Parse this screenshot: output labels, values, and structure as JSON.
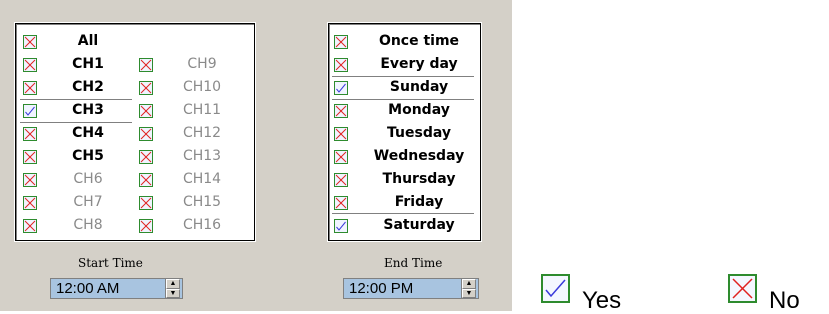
{
  "channels": {
    "col1": [
      {
        "label": "All",
        "state": "no",
        "enabled": true
      },
      {
        "label": "CH1",
        "state": "no",
        "enabled": true
      },
      {
        "label": "CH2",
        "state": "no",
        "enabled": true
      },
      {
        "label": "CH3",
        "state": "yes",
        "enabled": true
      },
      {
        "label": "CH4",
        "state": "no",
        "enabled": true
      },
      {
        "label": "CH5",
        "state": "no",
        "enabled": true
      },
      {
        "label": "CH6",
        "state": "no",
        "enabled": false
      },
      {
        "label": "CH7",
        "state": "no",
        "enabled": false
      },
      {
        "label": "CH8",
        "state": "no",
        "enabled": false
      }
    ],
    "col2": [
      {
        "label": "CH9",
        "state": "no",
        "enabled": false
      },
      {
        "label": "CH10",
        "state": "no",
        "enabled": false
      },
      {
        "label": "CH11",
        "state": "no",
        "enabled": false
      },
      {
        "label": "CH12",
        "state": "no",
        "enabled": false
      },
      {
        "label": "CH13",
        "state": "no",
        "enabled": false
      },
      {
        "label": "CH14",
        "state": "no",
        "enabled": false
      },
      {
        "label": "CH15",
        "state": "no",
        "enabled": false
      },
      {
        "label": "CH16",
        "state": "no",
        "enabled": false
      }
    ]
  },
  "days": [
    {
      "label": "Once time",
      "state": "no"
    },
    {
      "label": "Every day",
      "state": "no"
    },
    {
      "label": "Sunday",
      "state": "yes"
    },
    {
      "label": "Monday",
      "state": "no"
    },
    {
      "label": "Tuesday",
      "state": "no"
    },
    {
      "label": "Wednesday",
      "state": "no"
    },
    {
      "label": "Thursday",
      "state": "no"
    },
    {
      "label": "Friday",
      "state": "no"
    },
    {
      "label": "Saturday",
      "state": "yes"
    }
  ],
  "start_time": {
    "caption": "Start Time",
    "value": "12:00 AM"
  },
  "end_time": {
    "caption": "End Time",
    "value": "12:00 PM"
  },
  "legend": {
    "yes_label": "Yes",
    "no_label": "No"
  },
  "colors": {
    "check": "#3a3adb",
    "cross": "#e02020",
    "checkbox_border": "#2e8b2e",
    "panel": "#d4d0c8",
    "time_field": "#a8c4e0"
  }
}
